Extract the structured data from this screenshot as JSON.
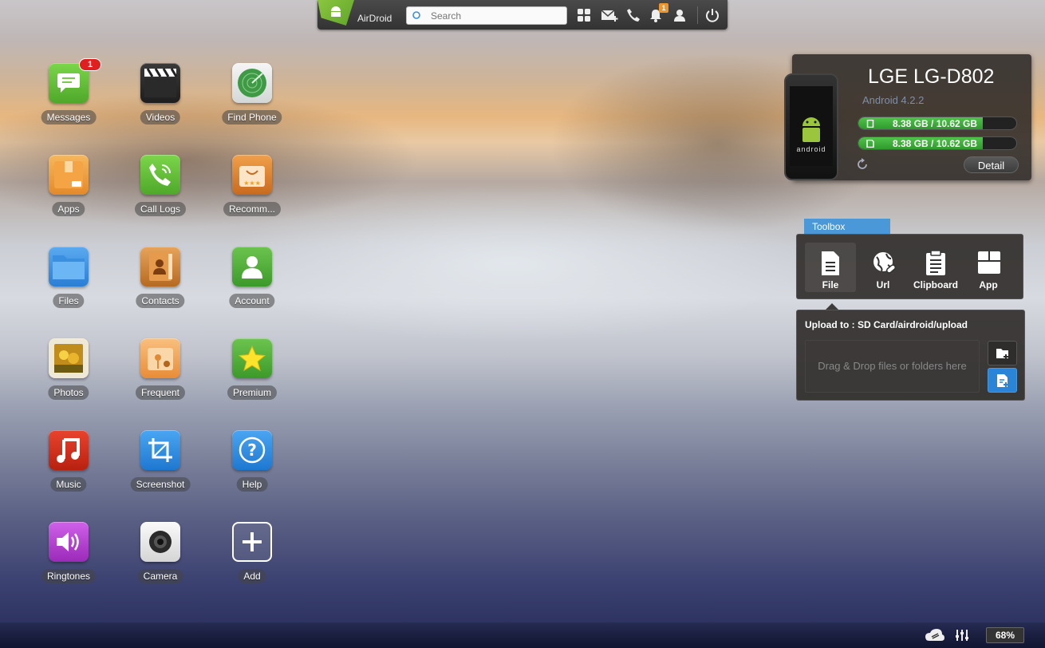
{
  "topbar": {
    "app_name": "AirDroid",
    "search_placeholder": "Search",
    "notification_count": "1"
  },
  "apps": [
    {
      "label": "Messages",
      "icon": "messages-icon",
      "color": "#5cb531",
      "badge": "1"
    },
    {
      "label": "Videos",
      "icon": "videos-icon",
      "color": "#2a2a2a"
    },
    {
      "label": "Find Phone",
      "icon": "find-phone-icon",
      "color": "#dfe3e2"
    },
    {
      "label": "Apps",
      "icon": "apps-icon",
      "color": "#f0a340"
    },
    {
      "label": "Call Logs",
      "icon": "call-logs-icon",
      "color": "#5cb531"
    },
    {
      "label": "Recomm...",
      "icon": "recommend-icon",
      "color": "#e88a2c"
    },
    {
      "label": "Files",
      "icon": "files-icon",
      "color": "#3b8fe0"
    },
    {
      "label": "Contacts",
      "icon": "contacts-icon",
      "color": "#d98a35"
    },
    {
      "label": "Account",
      "icon": "account-icon",
      "color": "#4ab03a"
    },
    {
      "label": "Photos",
      "icon": "photos-icon",
      "color": "#e9e1cc"
    },
    {
      "label": "Frequent",
      "icon": "frequent-icon",
      "color": "#f3a55a"
    },
    {
      "label": "Premium",
      "icon": "premium-icon",
      "color": "#4ab03a"
    },
    {
      "label": "Music",
      "icon": "music-icon",
      "color": "#d8321e"
    },
    {
      "label": "Screenshot",
      "icon": "screenshot-icon",
      "color": "#2f8fe0"
    },
    {
      "label": "Help",
      "icon": "help-icon",
      "color": "#2f8fe0"
    },
    {
      "label": "Ringtones",
      "icon": "ringtones-icon",
      "color": "#b63fd4"
    },
    {
      "label": "Camera",
      "icon": "camera-icon",
      "color": "#eaeaea"
    },
    {
      "label": "Add",
      "icon": "add-icon",
      "color": "transparent"
    }
  ],
  "device": {
    "name": "LGE LG-D802",
    "os": "Android 4.2.2",
    "storage": [
      {
        "text": "8.38 GB / 10.62 GB",
        "used_fraction": 0.79,
        "icon": "phone-storage-icon"
      },
      {
        "text": "8.38 GB / 10.62 GB",
        "used_fraction": 0.79,
        "icon": "sd-card-icon"
      }
    ],
    "detail_label": "Detail",
    "phone_logo_text": "android"
  },
  "toolbox": {
    "tab_label": "Toolbox",
    "tools": [
      {
        "label": "File",
        "icon": "file-icon",
        "active": true
      },
      {
        "label": "Url",
        "icon": "url-icon",
        "active": false
      },
      {
        "label": "Clipboard",
        "icon": "clipboard-icon",
        "active": false
      },
      {
        "label": "App",
        "icon": "app-box-icon",
        "active": false
      }
    ],
    "upload_title": "Upload to : SD Card/airdroid/upload",
    "dropzone_text": "Drag & Drop files or folders here"
  },
  "status": {
    "battery": "68%"
  },
  "colors": {
    "accent_blue": "#4a98d8",
    "storage_green": "#3aae35",
    "badge_red": "#e02020",
    "notif_orange": "#f0952a"
  }
}
